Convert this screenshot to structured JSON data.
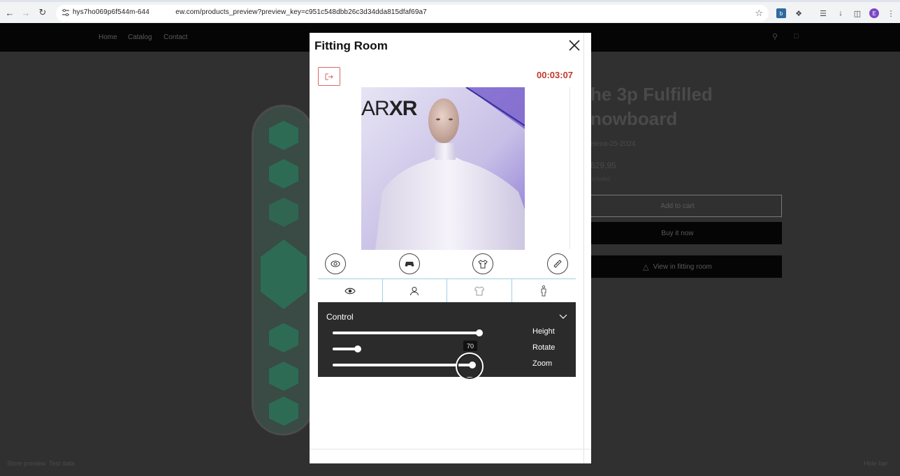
{
  "browser": {
    "url": "hys7ho069p6f544m-644             ew.com/products_preview?preview_key=c951c548dbb26c3d34dda815dfaf69a7",
    "avatar_letter": "E"
  },
  "store": {
    "nav": [
      "Home",
      "Catalog",
      "Contact"
    ],
    "product_title_line1": "he 3p Fulfilled",
    "product_title_line2": "nowboard",
    "vendor": "elena-25-2024",
    "price": "629,95",
    "tax_note": "ncluded.",
    "add_to_cart": "Add to cart",
    "buy_now": "Buy it now",
    "view_fitting": "View in fitting room",
    "bottom_left": "Store preview  Test data",
    "bottom_right": "Hide bar"
  },
  "modal": {
    "title": "Fitting Room",
    "timer": "00:03:07",
    "viewport_logo": "AR",
    "viewport_logo_bold": "XR",
    "control": {
      "title": "Control",
      "sliders": [
        {
          "label": "Height",
          "value": 1.0
        },
        {
          "label": "Rotate",
          "value": 0.17
        },
        {
          "label": "Zoom",
          "value": 0.95
        }
      ],
      "tooltip": "70"
    }
  },
  "colors": {
    "accent_red": "#c0392b",
    "tab_border": "#9fd0e6",
    "control_bg": "#2b2b2b"
  },
  "icons": {
    "action_buttons": [
      "view-toggle-icon",
      "gamepad-icon",
      "shirt-icon",
      "measure-icon"
    ],
    "tabs": [
      "eye-icon",
      "user-icon",
      "tshirt-icon",
      "body-icon"
    ]
  }
}
